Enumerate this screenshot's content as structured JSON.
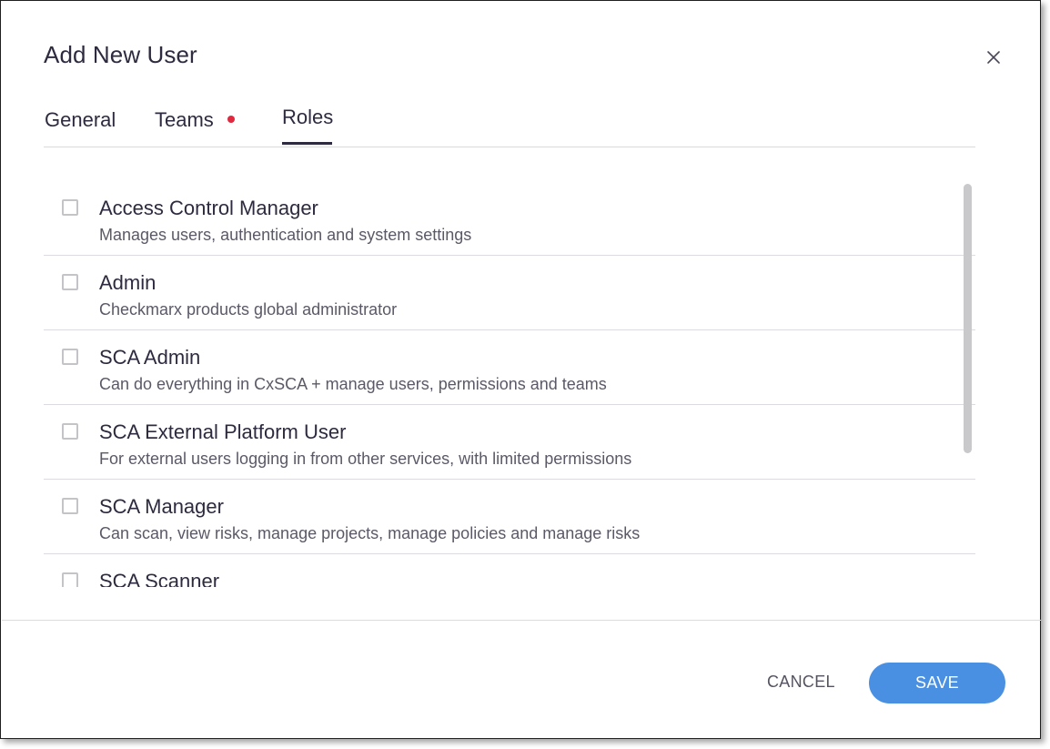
{
  "dialog": {
    "title": "Add New User",
    "close_icon": "close-icon"
  },
  "tabs": [
    {
      "label": "General",
      "active": false
    },
    {
      "label": "Teams",
      "active": false,
      "has_alert_dot": true
    },
    {
      "label": "Roles",
      "active": true
    }
  ],
  "roles": [
    {
      "name": "Access Control Manager",
      "description": "Manages users, authentication and system settings",
      "checked": false
    },
    {
      "name": "Admin",
      "description": "Checkmarx products global administrator",
      "checked": false
    },
    {
      "name": "SCA Admin",
      "description": "Can do everything in CxSCA + manage users, permissions and teams",
      "checked": false
    },
    {
      "name": "SCA External Platform User",
      "description": "For external users logging in from other services, with limited permissions",
      "checked": false
    },
    {
      "name": "SCA Manager",
      "description": "Can scan, view risks, manage projects, manage policies and manage risks",
      "checked": false
    },
    {
      "name": "SCA Scanner",
      "description": "",
      "checked": false
    }
  ],
  "footer": {
    "cancel_label": "CANCEL",
    "save_label": "SAVE"
  },
  "colors": {
    "accent": "#4a90e2",
    "alert_dot": "#e0283e",
    "text_primary": "#2e2a3f"
  }
}
